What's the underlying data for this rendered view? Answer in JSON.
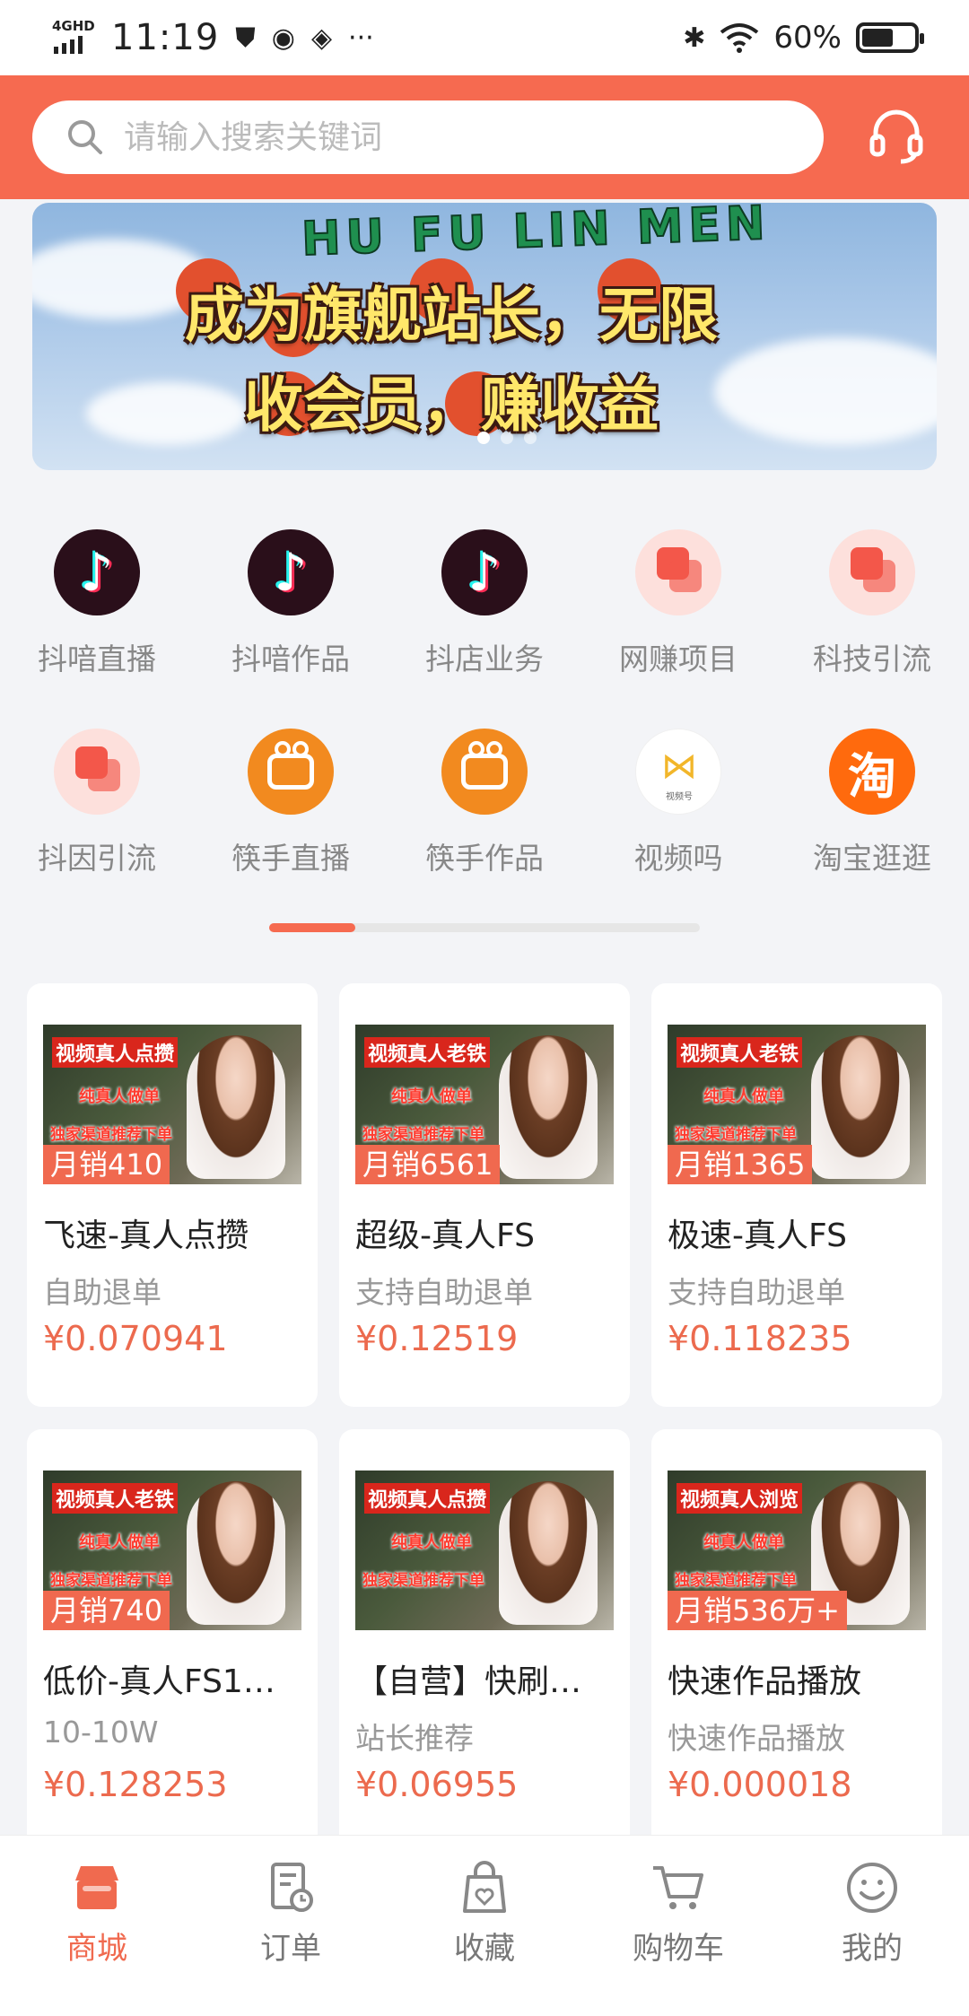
{
  "status_bar": {
    "network": "4GHD",
    "time": "11:19",
    "battery": "60%",
    "battery_level": 0.6,
    "icons": [
      "shield-icon",
      "message-icon",
      "flame-icon",
      "more-icon",
      "bluetooth-icon",
      "wifi-icon",
      "battery-icon"
    ]
  },
  "header": {
    "search_placeholder": "请输入搜索关键词",
    "support_icon": "headset-icon",
    "accent": "#f66a50"
  },
  "banner": {
    "arc_text": "HU FU LIN MEN",
    "line1": "成为旗舰站长，无限",
    "line2": "收会员，赚收益",
    "active_dot": 0,
    "dot_count": 3
  },
  "categories": [
    {
      "label": "抖喑直播",
      "icon": "tiktok-icon"
    },
    {
      "label": "抖喑作品",
      "icon": "tiktok-icon"
    },
    {
      "label": "抖店业务",
      "icon": "tiktok-icon"
    },
    {
      "label": "网赚项目",
      "icon": "squares-icon"
    },
    {
      "label": "科技引流",
      "icon": "squares-icon"
    },
    {
      "label": "抖因引流",
      "icon": "squares-icon"
    },
    {
      "label": "筷手直播",
      "icon": "kuaishou-icon"
    },
    {
      "label": "筷手作品",
      "icon": "kuaishou-icon"
    },
    {
      "label": "视频吗",
      "icon": "shipinhao-icon",
      "icon_text": "视频号"
    },
    {
      "label": "淘宝逛逛",
      "icon": "taobao-icon",
      "icon_text": "淘"
    }
  ],
  "category_page_progress": 0.2,
  "products": [
    {
      "thumb_title": "视频真人点攒",
      "thumb_line2": "纯真人做单",
      "thumb_line3": "独家渠道推荐下单",
      "sales": "月销410",
      "title": "飞速-真人点攒",
      "subtitle": "自助退单",
      "price": "¥0.070941"
    },
    {
      "thumb_title": "视频真人老铁",
      "thumb_line2": "纯真人做单",
      "thumb_line3": "独家渠道推荐下单",
      "sales": "月销6561",
      "title": "超级-真人FS",
      "subtitle": "支持自助退单",
      "price": "¥0.12519"
    },
    {
      "thumb_title": "视频真人老铁",
      "thumb_line2": "纯真人做单",
      "thumb_line3": "独家渠道推荐下单",
      "sales": "月销1365",
      "title": "极速-真人FS",
      "subtitle": "支持自助退单",
      "price": "¥0.118235"
    },
    {
      "thumb_title": "视频真人老铁",
      "thumb_line2": "纯真人做单",
      "thumb_line3": "独家渠道推荐下单",
      "sales": "月销740",
      "title": "低价-真人FS1…",
      "subtitle": "10-10W",
      "price": "¥0.128253"
    },
    {
      "thumb_title": "视频真人点攒",
      "thumb_line2": "纯真人做单",
      "thumb_line3": "独家渠道推荐下单",
      "sales": "",
      "title": "【自营】快刷…",
      "subtitle": "站长推荐",
      "price": "¥0.06955"
    },
    {
      "thumb_title": "视频真人浏览",
      "thumb_line2": "纯真人做单",
      "thumb_line3": "独家渠道推荐下单",
      "sales": "月销536万+",
      "title": "快速作品播放",
      "subtitle": "快速作品播放",
      "price": "¥0.000018"
    }
  ],
  "bottom_nav": [
    {
      "label": "商城",
      "icon": "shop-icon",
      "active": true
    },
    {
      "label": "订单",
      "icon": "order-icon",
      "active": false
    },
    {
      "label": "收藏",
      "icon": "favorite-bag-icon",
      "active": false
    },
    {
      "label": "购物车",
      "icon": "cart-icon",
      "active": false
    },
    {
      "label": "我的",
      "icon": "smile-icon",
      "active": false
    }
  ]
}
